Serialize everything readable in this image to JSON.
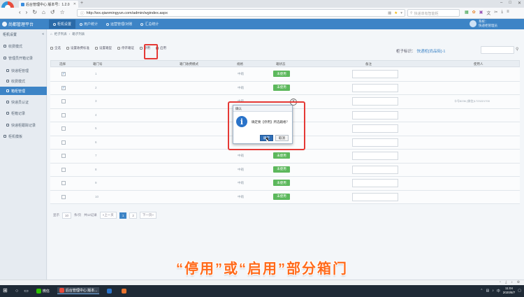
{
  "browser": {
    "tab_title": "后台管理中心 版本号：1.2.0",
    "new_tab": "+",
    "url": "http://wx.qianmingyun.com/admin/wgindex.aspx",
    "search_placeholder": "快递单有智能柜",
    "win_min": "–",
    "win_max": "□",
    "win_close": "✕"
  },
  "app": {
    "logo_text": "尚都管理平台",
    "tabs": [
      {
        "label": "柜机设置",
        "active": true
      },
      {
        "label": "用户统计",
        "active": false
      },
      {
        "label": "运营管理/对账",
        "active": false
      },
      {
        "label": "汇总统计",
        "active": false
      }
    ],
    "user_line1": "系统：",
    "user_line2": "快递柜管理员"
  },
  "sidebar": {
    "header": "柜机设置",
    "items": [
      {
        "label": "收费模式",
        "selected": false,
        "indent": false
      },
      {
        "label": "管理员开箱记录",
        "selected": false,
        "indent": false
      },
      {
        "label": "快递柜管理",
        "selected": false,
        "indent": true
      },
      {
        "label": "收费模式",
        "selected": false,
        "indent": true
      },
      {
        "label": "箱柜管理",
        "selected": true,
        "indent": true
      },
      {
        "label": "快递员认证",
        "selected": false,
        "indent": true
      },
      {
        "label": "柜箱记录",
        "selected": false,
        "indent": true
      },
      {
        "label": "快递柜跟踪记录",
        "selected": false,
        "indent": true
      },
      {
        "label": "柜机模板",
        "selected": false,
        "indent": false
      }
    ]
  },
  "breadcrumb": [
    "柜子列表",
    "›",
    "箱子列表"
  ],
  "toolbar": {
    "items": [
      "全选",
      "设置收费标准",
      "设置箱型",
      "停开箱证",
      "停用",
      "启用"
    ]
  },
  "cabinet": {
    "label": "柜子标识：",
    "value": "快递柜[尚品街]-1"
  },
  "table": {
    "headers": [
      "选择",
      "箱门号",
      "箱门收费模式",
      "规格",
      "箱状态",
      "备注",
      "使用人"
    ],
    "rows": [
      {
        "checked": true,
        "num": "1",
        "size": "中箱",
        "status": "未使用",
        "user": ""
      },
      {
        "checked": true,
        "num": "2",
        "size": "中箱",
        "status": "未使用",
        "user": ""
      },
      {
        "checked": false,
        "num": "3",
        "size": "中箱",
        "status": "",
        "user": "卡号8236 (微信)1723221700"
      },
      {
        "checked": false,
        "num": "4",
        "size": "中箱",
        "status": "",
        "user": ""
      },
      {
        "checked": false,
        "num": "5",
        "size": "中箱",
        "status": "",
        "user": ""
      },
      {
        "checked": false,
        "num": "6",
        "size": "中箱",
        "status": "",
        "user": ""
      },
      {
        "checked": false,
        "num": "7",
        "size": "中箱",
        "status": "未使用",
        "user": ""
      },
      {
        "checked": false,
        "num": "8",
        "size": "中箱",
        "status": "未使用",
        "user": ""
      },
      {
        "checked": false,
        "num": "9",
        "size": "中箱",
        "status": "未使用",
        "user": ""
      },
      {
        "checked": false,
        "num": "10",
        "size": "中箱",
        "status": "未使用",
        "user": ""
      }
    ]
  },
  "pagination": {
    "show": "显示",
    "per_page": "10",
    "unit": "条/页",
    "total": "共12记录",
    "prev": "«上一页",
    "pages": [
      "1",
      "2"
    ],
    "current": "1",
    "next": "下一页»"
  },
  "dialog": {
    "title": "确认",
    "message": "确定要【停用】所选箱格？",
    "ok": "确定",
    "cancel": "取消",
    "close": "×"
  },
  "caption": "“停用”或“启用”部分箱门",
  "taskbar": {
    "apps": [
      {
        "label": "微信",
        "color": "#2dc100",
        "active": false
      },
      {
        "label": "后台管理中心 版本...",
        "color": "#e74c3c",
        "active": true
      },
      {
        "label": "",
        "color": "#2b73c9",
        "active": false
      },
      {
        "label": "",
        "color": "#e8732e",
        "active": false
      }
    ],
    "time": "11:04",
    "date": "2020/8/7"
  },
  "colors": {
    "header_blue": "#3d84c6",
    "highlight_red": "#e53935",
    "caption_orange": "#ff6a1a",
    "status_green": "#5cb85c"
  }
}
